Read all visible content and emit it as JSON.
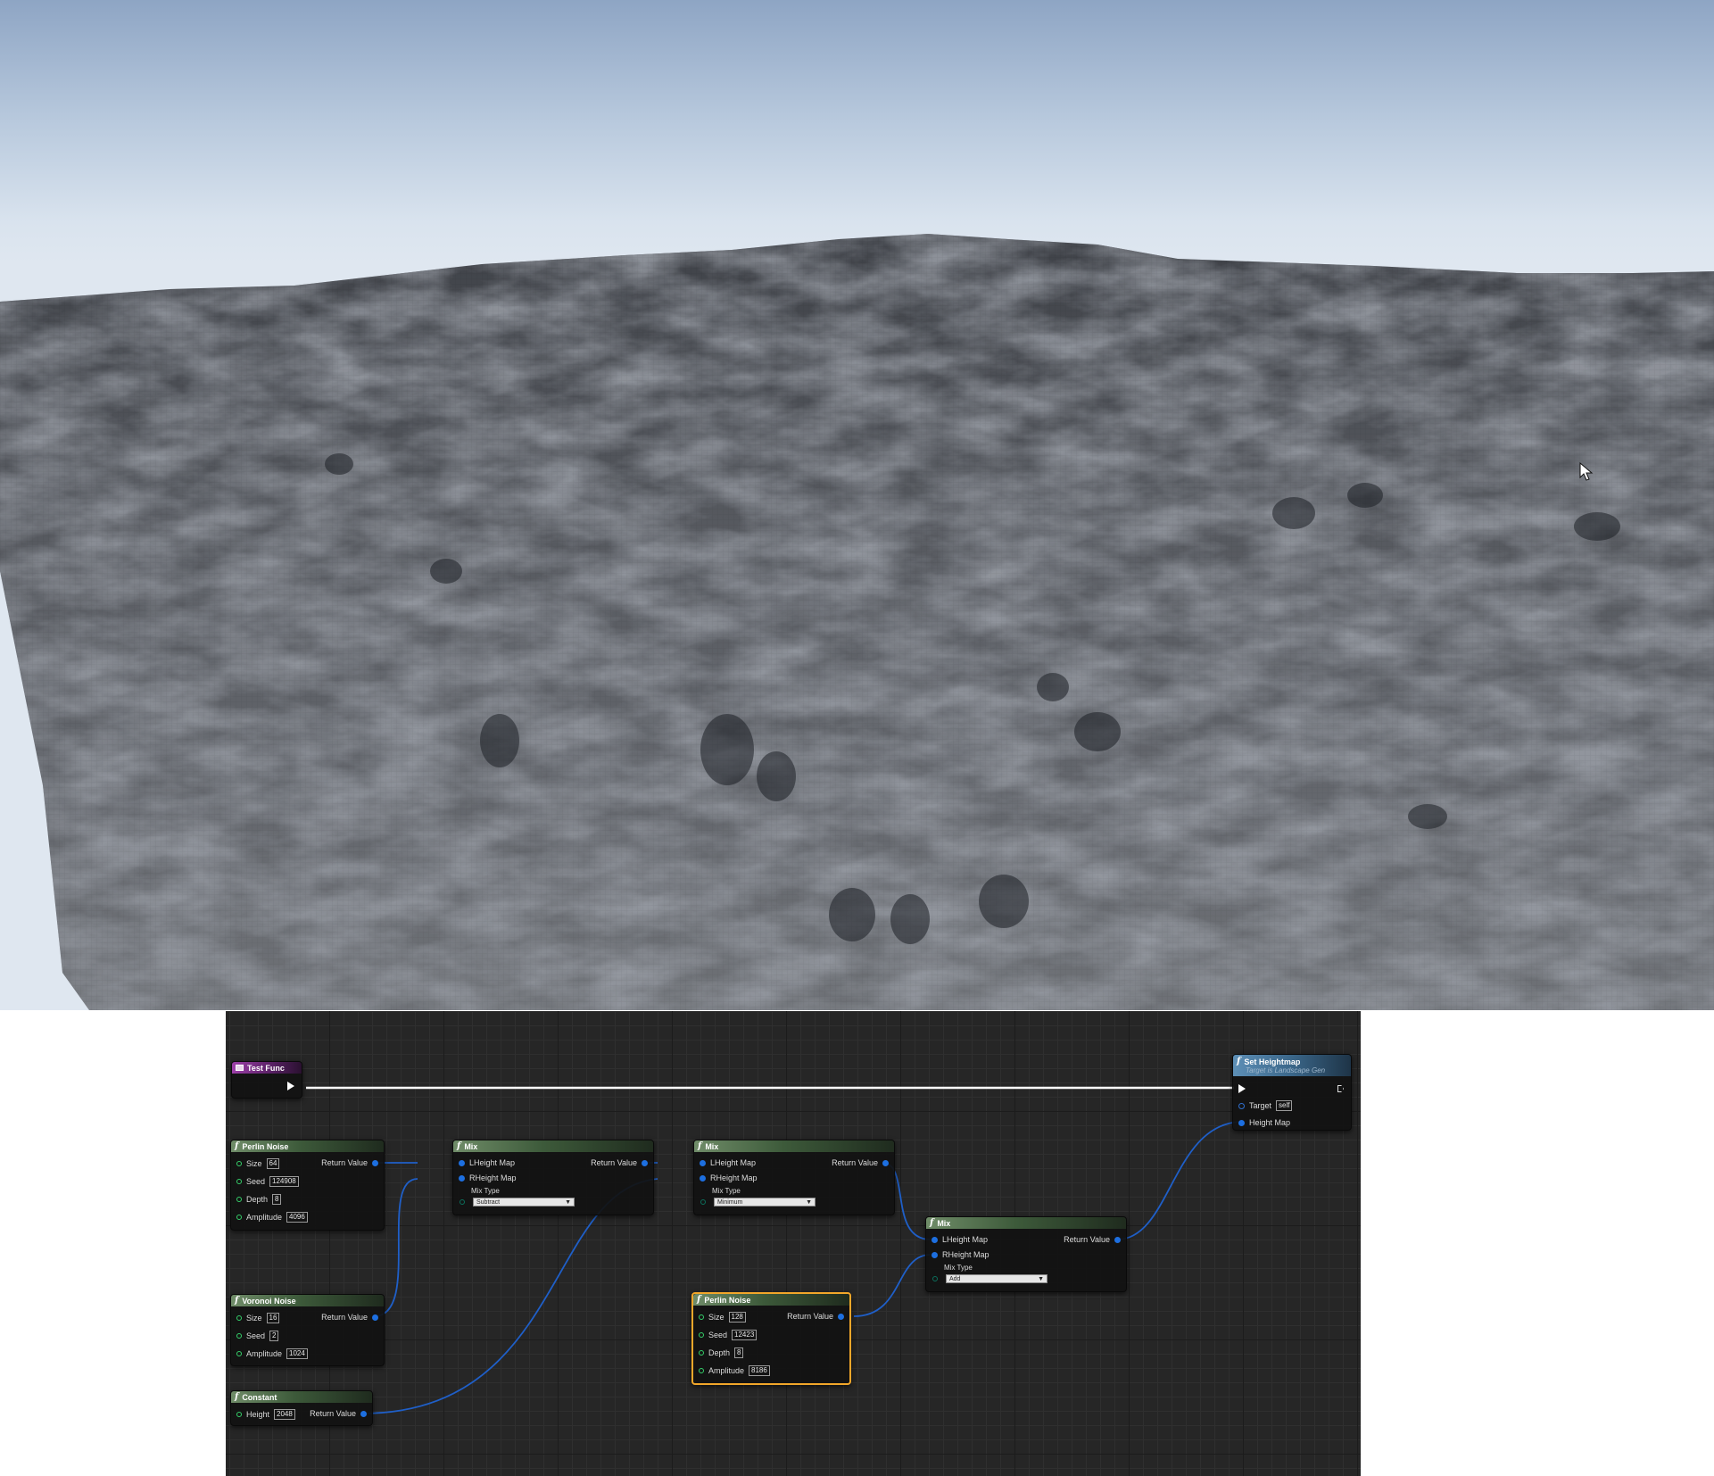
{
  "nodes": {
    "test_func": {
      "title": "Test Func"
    },
    "perlin1": {
      "title": "Perlin Noise",
      "size_label": "Size",
      "size": "64",
      "seed_label": "Seed",
      "seed": "124908",
      "depth_label": "Depth",
      "depth": "8",
      "amplitude_label": "Amplitude",
      "amplitude": "4096",
      "return_label": "Return Value"
    },
    "voronoi": {
      "title": "Voronoi Noise",
      "size_label": "Size",
      "size": "16",
      "seed_label": "Seed",
      "seed": "2",
      "amplitude_label": "Amplitude",
      "amplitude": "1024",
      "return_label": "Return Value"
    },
    "constant": {
      "title": "Constant",
      "height_label": "Height",
      "height": "2048",
      "return_label": "Return Value"
    },
    "mix1": {
      "title": "Mix",
      "lhm_label": "LHeight Map",
      "rhm_label": "RHeight Map",
      "mixtype_label": "Mix Type",
      "mixtype": "Subtract",
      "return_label": "Return Value"
    },
    "mix2": {
      "title": "Mix",
      "lhm_label": "LHeight Map",
      "rhm_label": "RHeight Map",
      "mixtype_label": "Mix Type",
      "mixtype": "Minimum",
      "return_label": "Return Value"
    },
    "mix3": {
      "title": "Mix",
      "lhm_label": "LHeight Map",
      "rhm_label": "RHeight Map",
      "mixtype_label": "Mix Type",
      "mixtype": "Add",
      "return_label": "Return Value"
    },
    "perlin2": {
      "title": "Perlin Noise",
      "size_label": "Size",
      "size": "128",
      "seed_label": "Seed",
      "seed": "12423",
      "depth_label": "Depth",
      "depth": "8",
      "amplitude_label": "Amplitude",
      "amplitude": "8186",
      "return_label": "Return Value"
    },
    "set_heightmap": {
      "title": "Set Heightmap",
      "subtitle": "Target is Landscape Gen",
      "target_label": "Target",
      "target": "self",
      "heightmap_label": "Height Map"
    }
  },
  "icons": {
    "function": "f",
    "event": "event-icon",
    "cursor": "cursor-arrow-icon"
  },
  "colors": {
    "exec_wire": "#ffffff",
    "data_wire": "#1f5fc8",
    "int_pin": "#35d06a",
    "selected_outline": "#f2a72a",
    "sky_top": "#8ea5c4",
    "sky_horizon": "#dfe7f0",
    "terrain": "#5e6167"
  }
}
